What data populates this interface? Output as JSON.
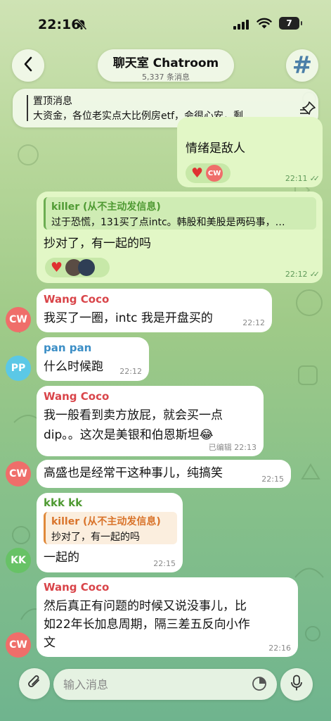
{
  "status_bar": {
    "time": "22:16",
    "battery": "7"
  },
  "header": {
    "title": "聊天室 Chatroom",
    "subtitle": "5,337 条消息"
  },
  "pinned": {
    "title": "置顶消息",
    "text": "大资金，各位老实点大比例房etf，会很心安，剩…"
  },
  "messages": [
    {
      "text": "情绪是敌人",
      "time": "22:11",
      "reaction_avatar": "CW"
    },
    {
      "reply_name": "killer (从不主动发信息)",
      "reply_text": "过于恐慌，131买了点intc。韩股和美股是两码事，…",
      "text": "抄对了，有一起的吗",
      "time": "22:12"
    },
    {
      "sender": "Wang Coco",
      "text": "我买了一圈，intc 我是开盘买的",
      "time": "22:12",
      "avatar": "CW"
    },
    {
      "sender": "pan pan",
      "text": "什么时候跑",
      "time": "22:12",
      "avatar": "PP"
    },
    {
      "sender": "Wang Coco",
      "line1": "我一般看到卖方放屁，就会买一点",
      "line2": "dip。。这次是美银和伯恩斯坦😂",
      "edited": "已编辑",
      "time": "22:13"
    },
    {
      "text": "高盛也是经常干这种事儿，纯搞笑",
      "time": "22:15",
      "avatar": "CW"
    },
    {
      "sender": "kkk kk",
      "reply_name": "killer (从不主动发信息)",
      "reply_text": "抄对了，有一起的吗",
      "text": "一起的",
      "time": "22:15",
      "avatar": "KK"
    },
    {
      "sender": "Wang Coco",
      "line1": "然后真正有问题的时候又说没事儿，比",
      "line2": "如22年长加息周期，隔三差五反向小作",
      "line3": "文",
      "time": "22:16",
      "avatar": "CW"
    }
  ],
  "input": {
    "placeholder": "输入消息"
  },
  "colors": {
    "name_wang": "#d9454a",
    "name_pan": "#3b8ec6",
    "name_kkk": "#4f9a33",
    "reply_green_name": "#4f9a33",
    "reply_orange_name": "#d9732a",
    "avatar_cw": "#ef6e6a",
    "avatar_pp": "#5bc8e6",
    "avatar_kk": "#67c266"
  },
  "icons": [
    "chevron-left-icon",
    "hash-icon",
    "pin-icon",
    "heart-icon",
    "paperclip-icon",
    "sticker-icon",
    "microphone-icon",
    "bell-slash-icon",
    "signal-icon",
    "wifi-icon"
  ]
}
